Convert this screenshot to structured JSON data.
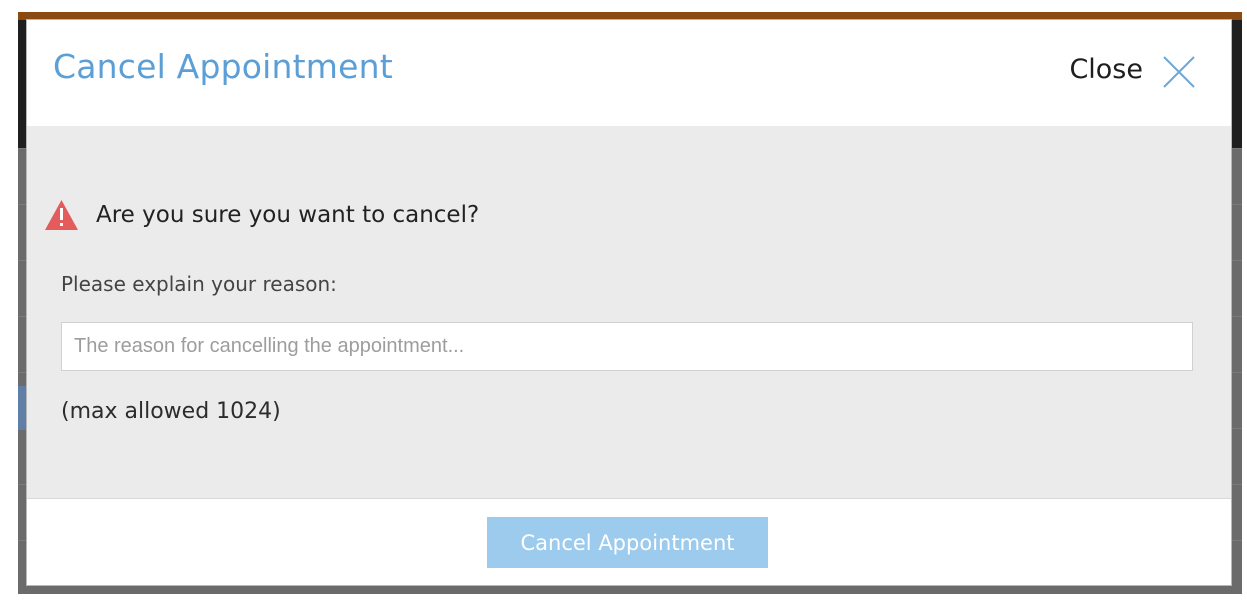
{
  "dialog": {
    "title": "Cancel Appointment",
    "close_label": "Close",
    "warning_message": "Are you sure you want to cancel?",
    "reason_label": "Please explain your reason:",
    "reason_placeholder": "The reason for cancelling the appointment...",
    "reason_value": "",
    "max_allowed_text": "(max allowed 1024)",
    "submit_label": "Cancel Appointment",
    "submit_disabled": true
  },
  "icons": {
    "close": "close-icon",
    "warning": "warning-icon"
  },
  "colors": {
    "title": "#5b9fd6",
    "warning": "#e45b5b",
    "button_disabled": "#9ccbed",
    "backdrop_top": "#8a4a12"
  }
}
